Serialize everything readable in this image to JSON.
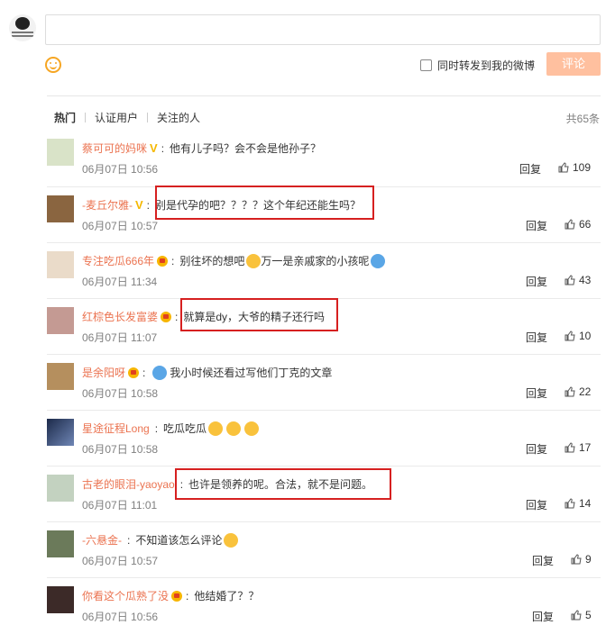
{
  "composer": {
    "repost_label": "同时转发到我的微博",
    "submit_label": "评论"
  },
  "tabs": [
    "热门",
    "认证用户",
    "关注的人"
  ],
  "total": "共65条",
  "reply_label": "回复",
  "comments": [
    {
      "name": "蔡可可的妈咪",
      "badge": "v",
      "text": "他有儿子吗？会不会是他孙子？",
      "time": "06月07日 10:56",
      "likes": "109"
    },
    {
      "name": "-麦丘尔雅-",
      "badge": "v",
      "text": "别是代孕的吧？？？？这个年纪还能生吗？",
      "time": "06月07日 10:57",
      "likes": "66"
    },
    {
      "name": "专注吃瓜666年",
      "badge": "crown",
      "text": "别往坏的想吧",
      "text2": "万一是亲戚家的小孩呢",
      "time": "06月07日 11:34",
      "likes": "43"
    },
    {
      "name": "红棕色长发富婆",
      "badge": "crown",
      "text": "就算是dy，大爷的精子还行吗",
      "time": "06月07日 11:07",
      "likes": "10"
    },
    {
      "name": "是余阳呀",
      "badge": "crown",
      "text": "我小时候还看过写他们丁克的文章",
      "time": "06月07日 10:58",
      "likes": "22"
    },
    {
      "name": "星途征程Long",
      "badge": "",
      "text": "吃瓜吃瓜",
      "time": "06月07日 10:58",
      "likes": "17"
    },
    {
      "name": "古老的眼泪-yaoyao",
      "badge": "",
      "text": "也许是领养的呢。合法，就不是问题。",
      "time": "06月07日 11:01",
      "likes": "14"
    },
    {
      "name": "-六悬金-",
      "badge": "",
      "text": "不知道该怎么评论",
      "time": "06月07日 10:57",
      "likes": "9"
    },
    {
      "name": "你看这个瓜熟了没",
      "badge": "crown",
      "text": "他结婚了？？",
      "time": "06月07日 10:56",
      "likes": "5"
    }
  ]
}
